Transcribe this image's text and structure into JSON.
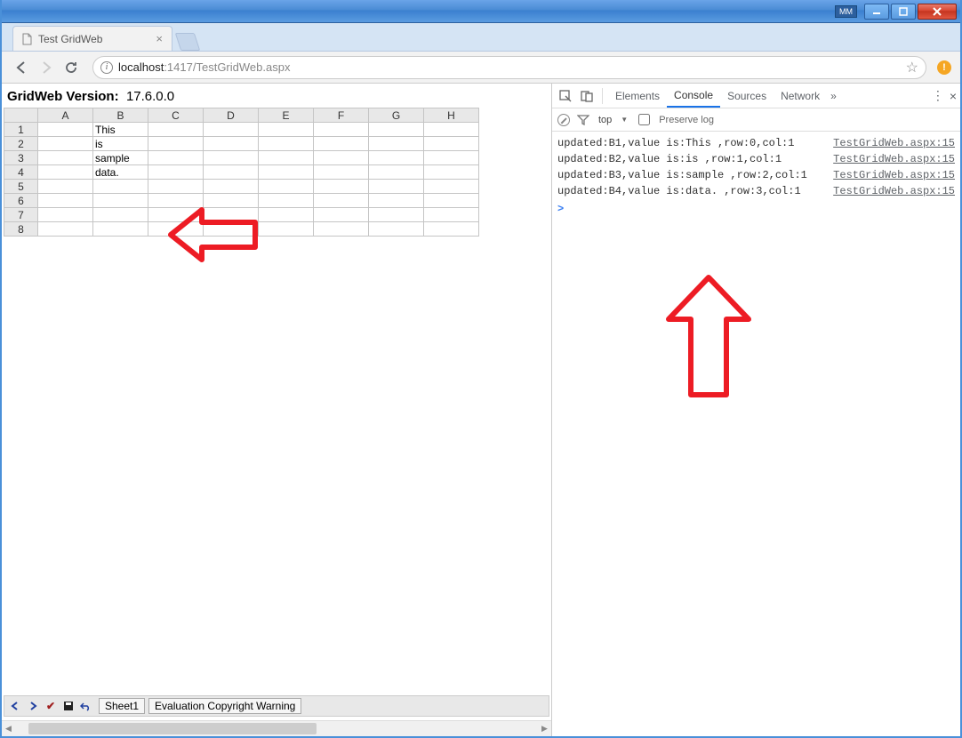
{
  "window": {
    "badge": "MM"
  },
  "browser": {
    "tab_title": "Test GridWeb",
    "url_host": "localhost",
    "url_port": ":1417",
    "url_path": "/TestGridWeb.aspx"
  },
  "page": {
    "version_label": "GridWeb Version:",
    "version_value": "17.6.0.0",
    "columns": [
      "A",
      "B",
      "C",
      "D",
      "E",
      "F",
      "G",
      "H"
    ],
    "rows": [
      {
        "n": "1",
        "cells": [
          "",
          "This",
          "",
          "",
          "",
          "",
          "",
          ""
        ]
      },
      {
        "n": "2",
        "cells": [
          "",
          "is",
          "",
          "",
          "",
          "",
          "",
          ""
        ]
      },
      {
        "n": "3",
        "cells": [
          "",
          "sample",
          "",
          "",
          "",
          "",
          "",
          ""
        ]
      },
      {
        "n": "4",
        "cells": [
          "",
          "data.",
          "",
          "",
          "",
          "",
          "",
          ""
        ]
      },
      {
        "n": "5",
        "cells": [
          "",
          "",
          "",
          "",
          "",
          "",
          "",
          ""
        ]
      },
      {
        "n": "6",
        "cells": [
          "",
          "",
          "",
          "",
          "",
          "",
          "",
          ""
        ]
      },
      {
        "n": "7",
        "cells": [
          "",
          "",
          "",
          "",
          "",
          "",
          "",
          ""
        ]
      },
      {
        "n": "8",
        "cells": [
          "",
          "",
          "",
          "",
          "",
          "",
          "",
          ""
        ]
      }
    ],
    "sheet_tab": "Sheet1",
    "warning_tab": "Evaluation Copyright Warning"
  },
  "devtools": {
    "tabs": [
      "Elements",
      "Console",
      "Sources",
      "Network"
    ],
    "active_tab": "Console",
    "filter": {
      "top_label": "top",
      "preserve_label": "Preserve log"
    },
    "console": [
      {
        "msg": "updated:B1,value is:This ,row:0,col:1",
        "src": "TestGridWeb.aspx:15"
      },
      {
        "msg": "updated:B2,value is:is ,row:1,col:1",
        "src": "TestGridWeb.aspx:15"
      },
      {
        "msg": "updated:B3,value is:sample ,row:2,col:1",
        "src": "TestGridWeb.aspx:15"
      },
      {
        "msg": "updated:B4,value is:data. ,row:3,col:1",
        "src": "TestGridWeb.aspx:15"
      }
    ],
    "prompt_symbol": ">"
  }
}
